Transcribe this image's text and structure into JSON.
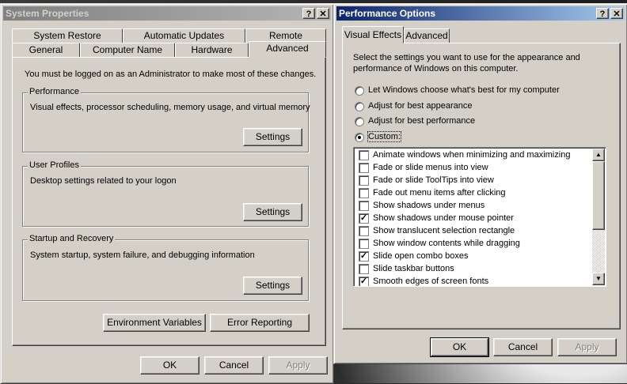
{
  "system_properties": {
    "title": "System Properties",
    "help_btn": "?",
    "close_btn": "✕",
    "tabs_row1": [
      "System Restore",
      "Automatic Updates",
      "Remote"
    ],
    "tabs_row2": [
      "General",
      "Computer Name",
      "Hardware",
      "Advanced"
    ],
    "admin_note": "You must be logged on as an Administrator to make most of these changes.",
    "performance": {
      "title": "Performance",
      "desc": "Visual effects, processor scheduling, memory usage, and virtual memory",
      "button": "Settings"
    },
    "user_profiles": {
      "title": "User Profiles",
      "desc": "Desktop settings related to your logon",
      "button": "Settings"
    },
    "startup_recovery": {
      "title": "Startup and Recovery",
      "desc": "System startup, system failure, and debugging information",
      "button": "Settings"
    },
    "env_vars_button": "Environment Variables",
    "error_reporting_button": "Error Reporting",
    "ok": "OK",
    "cancel": "Cancel",
    "apply": "Apply"
  },
  "performance_options": {
    "title": "Performance Options",
    "help_btn": "?",
    "close_btn": "✕",
    "tabs": [
      "Visual Effects",
      "Advanced"
    ],
    "intro": "Select the settings you want to use for the appearance and performance of Windows on this computer.",
    "radios": [
      {
        "label": "Let Windows choose what's best for my computer",
        "selected": false
      },
      {
        "label": "Adjust for best appearance",
        "selected": false
      },
      {
        "label": "Adjust for best performance",
        "selected": false
      },
      {
        "label": "Custom:",
        "selected": true
      }
    ],
    "effects": [
      {
        "label": "Animate windows when minimizing and maximizing",
        "checked": false
      },
      {
        "label": "Fade or slide menus into view",
        "checked": false
      },
      {
        "label": "Fade or slide ToolTips into view",
        "checked": false
      },
      {
        "label": "Fade out menu items after clicking",
        "checked": false
      },
      {
        "label": "Show shadows under menus",
        "checked": false
      },
      {
        "label": "Show shadows under mouse pointer",
        "checked": true
      },
      {
        "label": "Show translucent selection rectangle",
        "checked": false
      },
      {
        "label": "Show window contents while dragging",
        "checked": false
      },
      {
        "label": "Slide open combo boxes",
        "checked": true
      },
      {
        "label": "Slide taskbar buttons",
        "checked": false
      },
      {
        "label": "Smooth edges of screen fonts",
        "checked": true
      }
    ],
    "check_mark": "✓",
    "ok": "OK",
    "cancel": "Cancel",
    "apply": "Apply"
  }
}
